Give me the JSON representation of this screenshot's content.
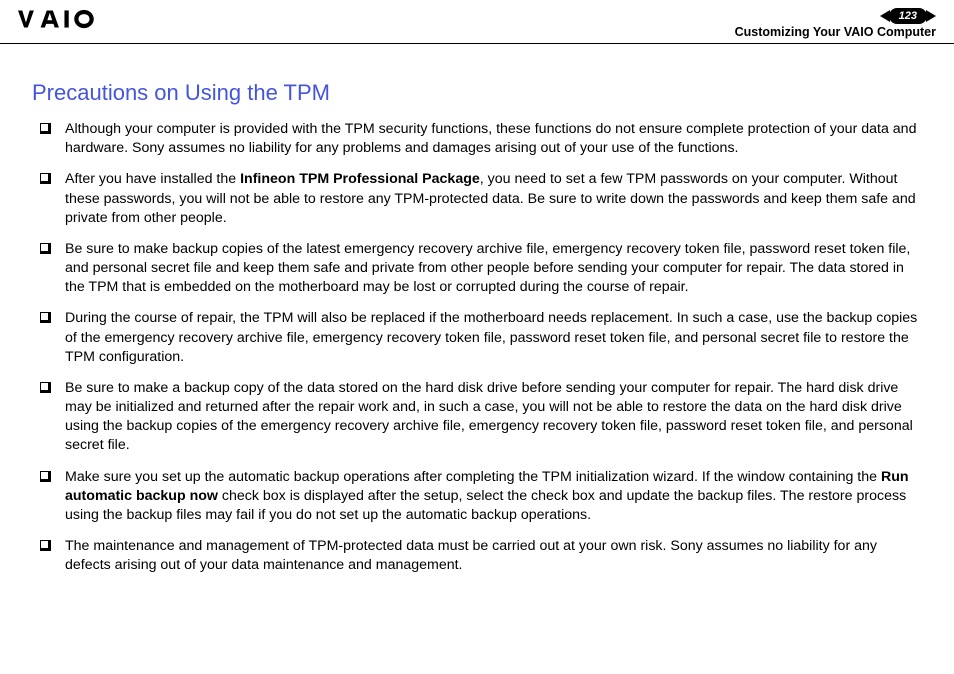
{
  "header": {
    "page_number": "123",
    "section": "Customizing Your VAIO Computer"
  },
  "title": "Precautions on Using the TPM",
  "items": [
    {
      "pre": "Although your computer is provided with the TPM security functions, these functions do not ensure complete protection of your data and hardware. Sony assumes no liability for any problems and damages arising out of your use of the functions.",
      "bold": "",
      "post": ""
    },
    {
      "pre": "After you have installed the ",
      "bold": "Infineon TPM Professional Package",
      "post": ", you need to set a few TPM passwords on your computer. Without these passwords, you will not be able to restore any TPM-protected data. Be sure to write down the passwords and keep them safe and private from other people."
    },
    {
      "pre": "Be sure to make backup copies of the latest emergency recovery archive file, emergency recovery token file, password reset token file, and personal secret file and keep them safe and private from other people before sending your computer for repair. The data stored in the TPM that is embedded on the motherboard may be lost or corrupted during the course of repair.",
      "bold": "",
      "post": ""
    },
    {
      "pre": "During the course of repair, the TPM will also be replaced if the motherboard needs replacement. In such a case, use the backup copies of the emergency recovery archive file, emergency recovery token file, password reset token file, and personal secret file to restore the TPM configuration.",
      "bold": "",
      "post": ""
    },
    {
      "pre": "Be sure to make a backup copy of the data stored on the hard disk drive before sending your computer for repair. The hard disk drive may be initialized and returned after the repair work and, in such a case, you will not be able to restore the data on the hard disk drive using the backup copies of the emergency recovery archive file, emergency recovery token file, password reset token file, and personal secret file.",
      "bold": "",
      "post": ""
    },
    {
      "pre": "Make sure you set up the automatic backup operations after completing the TPM initialization wizard. If the window containing the ",
      "bold": "Run automatic backup now",
      "post": " check box is displayed after the setup, select the check box and update the backup files. The restore process using the backup files may fail if you do not set up the automatic backup operations."
    },
    {
      "pre": "The maintenance and management of TPM-protected data must be carried out at your own risk. Sony assumes no liability for any defects arising out of your data maintenance and management.",
      "bold": "",
      "post": ""
    }
  ]
}
